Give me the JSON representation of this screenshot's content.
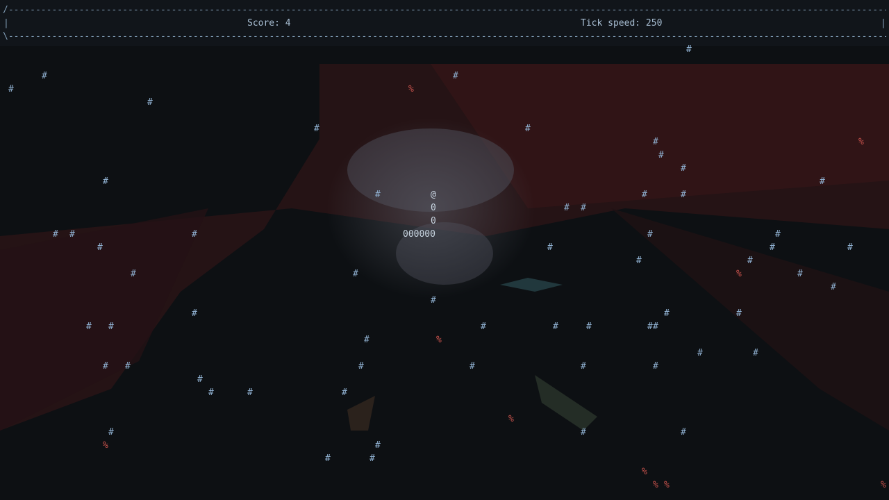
{
  "hud": {
    "top_border": "/----------------------------------------------------------------------------------------------------------------------------------------------------------------------------------------\\",
    "bottom_border": "\\----------------------------------------------------------------------------------------------------------------------------------------------------------------------------------------/",
    "side_char": "|",
    "score_text": "Score: 4",
    "tick_text": "Tick speed: 250"
  },
  "glyphs": {
    "wall": "#",
    "food": "%",
    "snake_head": "@",
    "snake_body": "0"
  },
  "colors": {
    "background": "#0d1013",
    "wall": "#8fb0d0",
    "food": "#c8524c",
    "snake": "#c9d6e2",
    "hud_text": "#a9bfd4"
  },
  "snake_rows": [
    "@",
    "0",
    "0",
    "000000"
  ]
}
